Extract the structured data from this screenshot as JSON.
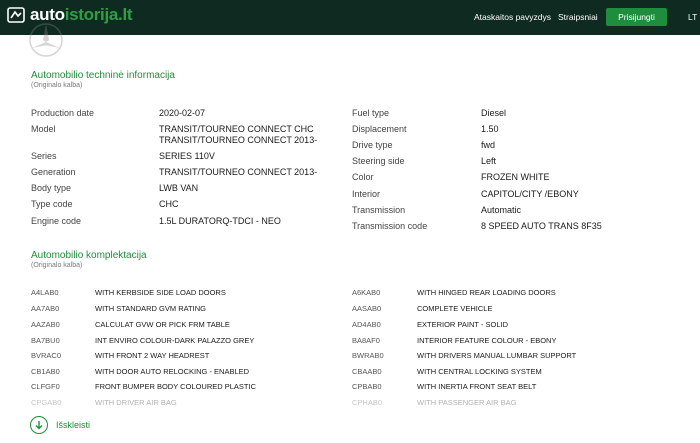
{
  "header": {
    "logo_a": "auto",
    "logo_b": "istorija.lt",
    "nav_example": "Ataskaitos pavyzdys",
    "nav_articles": "Straipsniai",
    "login": "Prisijungti",
    "lang": "LT"
  },
  "tech": {
    "title": "Automobilio techninė informacija",
    "subtitle": "(Originalo kalba)",
    "left": [
      {
        "label": "Production date",
        "value": "2020-02-07"
      },
      {
        "label": "Model",
        "value": "TRANSIT/TOURNEO CONNECT CHC",
        "value2": "TRANSIT/TOURNEO CONNECT 2013-"
      },
      {
        "label": "Series",
        "value": "SERIES 110V"
      },
      {
        "label": "Generation",
        "value": "TRANSIT/TOURNEO CONNECT 2013-"
      },
      {
        "label": "Body type",
        "value": "LWB VAN"
      },
      {
        "label": "Type code",
        "value": "CHC"
      },
      {
        "label": "Engine code",
        "value": "1.5L DURATORQ-TDCI - NEO"
      }
    ],
    "right": [
      {
        "label": "Fuel type",
        "value": "Diesel"
      },
      {
        "label": "Displacement",
        "value": "1.50"
      },
      {
        "label": "Drive type",
        "value": "fwd"
      },
      {
        "label": "Steering side",
        "value": "Left"
      },
      {
        "label": "Color",
        "value": "FROZEN WHITE"
      },
      {
        "label": "Interior",
        "value": "CAPITOL/CITY /EBONY"
      },
      {
        "label": "Transmission",
        "value": "Automatic"
      },
      {
        "label": "Transmission code",
        "value": "8 SPEED AUTO TRANS 8F35"
      }
    ]
  },
  "equip": {
    "title": "Automobilio komplektacija",
    "subtitle": "(Originalo kalba)",
    "left": [
      {
        "code": "A4LAB0",
        "desc": "WITH KERBSIDE SIDE LOAD DOORS"
      },
      {
        "code": "AA7AB0",
        "desc": "WITH STANDARD GVM RATING"
      },
      {
        "code": "AAZAB0",
        "desc": "CALCULAT GVW OR PICK FRM TABLE"
      },
      {
        "code": "BA7BU0",
        "desc": "INT ENVIRO COLOUR-DARK PALAZZO GREY"
      },
      {
        "code": "BVRAC0",
        "desc": "WITH FRONT 2 WAY HEADREST"
      },
      {
        "code": "CB1AB0",
        "desc": "WITH DOOR AUTO RELOCKING - ENABLED"
      },
      {
        "code": "CLFGF0",
        "desc": "FRONT BUMPER BODY COLOURED PLASTIC"
      },
      {
        "code": "CPGAB0",
        "desc": "WITH DRIVER AIR BAG"
      }
    ],
    "right": [
      {
        "code": "A6KAB0",
        "desc": "WITH HINGED REAR LOADING DOORS"
      },
      {
        "code": "AASAB0",
        "desc": "COMPLETE VEHICLE"
      },
      {
        "code": "AD4AB0",
        "desc": "EXTERIOR PAINT - SOLID"
      },
      {
        "code": "BA8AF0",
        "desc": "INTERIOR FEATURE COLOUR - EBONY"
      },
      {
        "code": "BWRAB0",
        "desc": "WITH DRIVERS MANUAL LUMBAR SUPPORT"
      },
      {
        "code": "CBAAB0",
        "desc": "WITH CENTRAL LOCKING SYSTEM"
      },
      {
        "code": "CPBAB0",
        "desc": "WITH INERTIA FRONT SEAT BELT"
      },
      {
        "code": "CPHAB0",
        "desc": "WITH PASSENGER AIR BAG"
      }
    ],
    "expand": "Išskleisti"
  },
  "colors": {
    "brand": "#1e8e3e",
    "header_bg": "#0f2b21"
  }
}
